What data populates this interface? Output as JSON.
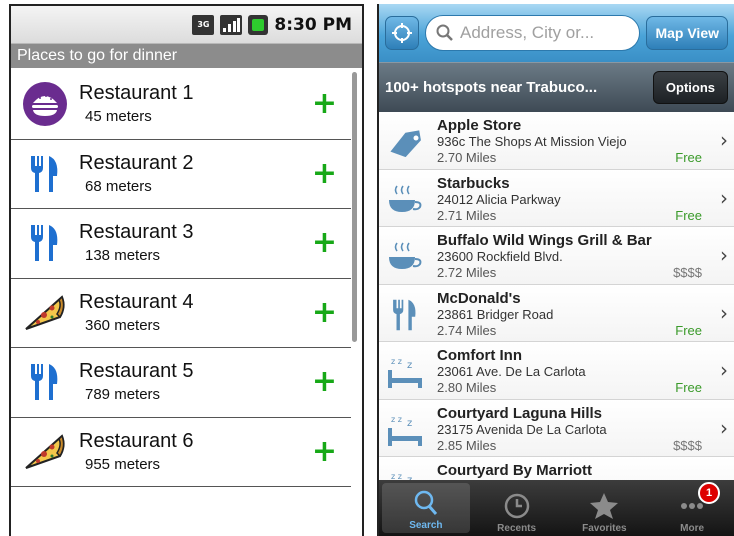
{
  "android": {
    "status": {
      "network": "3G",
      "time": "8:30 PM"
    },
    "header": "Places to go for dinner",
    "items": [
      {
        "name": "Restaurant 1",
        "distance": "45 meters",
        "icon": "burger-icon"
      },
      {
        "name": "Restaurant 2",
        "distance": "68 meters",
        "icon": "fork-knife-icon"
      },
      {
        "name": "Restaurant 3",
        "distance": "138 meters",
        "icon": "fork-knife-icon"
      },
      {
        "name": "Restaurant 4",
        "distance": "360 meters",
        "icon": "pizza-icon"
      },
      {
        "name": "Restaurant 5",
        "distance": "789 meters",
        "icon": "fork-knife-icon"
      },
      {
        "name": "Restaurant 6",
        "distance": "955 meters",
        "icon": "pizza-icon"
      }
    ],
    "add_label": "+",
    "colors": {
      "accent": "#17a817",
      "icon_blue": "#1e6fd0",
      "burger_purple": "#6a2c8f"
    }
  },
  "ios": {
    "search": {
      "placeholder": "Address, City or..."
    },
    "map_view_label": "Map View",
    "count_label": "100+ hotspots near Trabuco...",
    "options_label": "Options",
    "places": [
      {
        "name": "Apple Store",
        "address": "936c The Shops At Mission Viejo",
        "miles": "2.70 Miles",
        "price": "Free",
        "icon": "tag-icon"
      },
      {
        "name": "Starbucks",
        "address": "24012 Alicia Parkway",
        "miles": "2.71 Miles",
        "price": "Free",
        "icon": "coffee-icon"
      },
      {
        "name": "Buffalo Wild Wings Grill & Bar",
        "address": "23600 Rockfield Blvd.",
        "miles": "2.72 Miles",
        "price": "$$$$",
        "icon": "coffee-icon"
      },
      {
        "name": "McDonald's",
        "address": "23861 Bridger Road",
        "miles": "2.74 Miles",
        "price": "Free",
        "icon": "fork-knife-icon"
      },
      {
        "name": "Comfort Inn",
        "address": "23061 Ave. De La Carlota",
        "miles": "2.80 Miles",
        "price": "Free",
        "icon": "bed-icon"
      },
      {
        "name": "Courtyard Laguna Hills",
        "address": "23175 Avenida De La Carlota",
        "miles": "2.85 Miles",
        "price": "$$$$",
        "icon": "bed-icon"
      },
      {
        "name": "Courtyard By Marriott",
        "address": "",
        "miles": "",
        "price": "",
        "icon": "bed-icon"
      }
    ],
    "tabs": [
      {
        "label": "Search",
        "icon": "search-icon"
      },
      {
        "label": "Recents",
        "icon": "clock-icon"
      },
      {
        "label": "Favorites",
        "icon": "star-icon"
      },
      {
        "label": "More",
        "icon": "more-icon",
        "badge": "1"
      }
    ],
    "colors": {
      "free": "#3a9a2a",
      "top_bar": "#4aa3d8",
      "tab_active": "#6eb8f0"
    }
  }
}
